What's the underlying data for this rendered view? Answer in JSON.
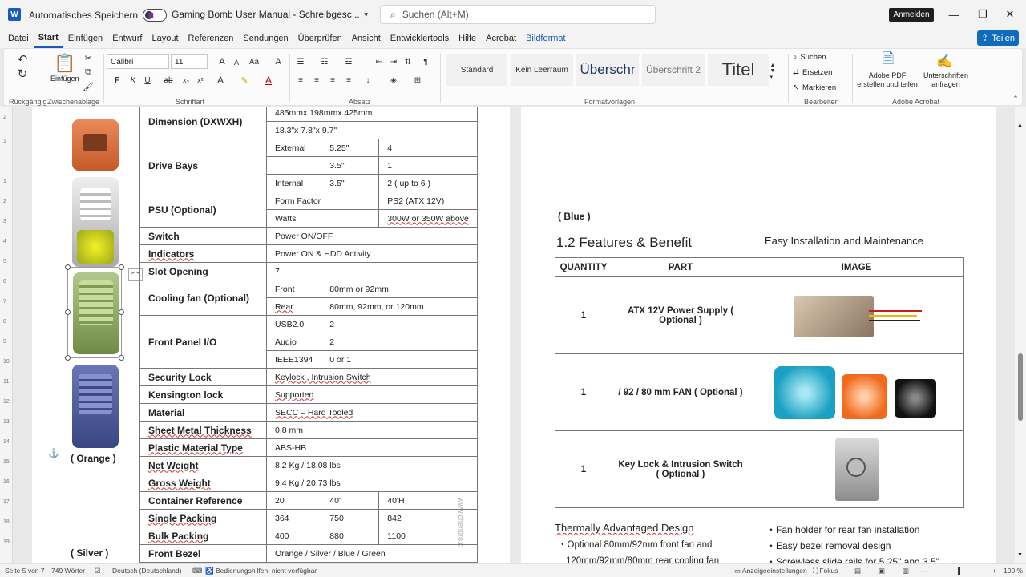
{
  "titlebar": {
    "autosave_label": "Automatisches Speichern",
    "doc_title": "Gaming Bomb User Manual - Schreibgesc...",
    "search_placeholder": "Suchen (Alt+M)",
    "signin_label": "Anmelden"
  },
  "menu": {
    "items": [
      "Datei",
      "Start",
      "Einfügen",
      "Entwurf",
      "Layout",
      "Referenzen",
      "Sendungen",
      "Überprüfen",
      "Ansicht",
      "Entwicklertools",
      "Hilfe",
      "Acrobat"
    ],
    "context_tab": "Bildformat",
    "share_label": "Teilen"
  },
  "ribbon": {
    "paste_label": "Einfügen",
    "font_name": "Calibri",
    "font_size": "11",
    "styles": [
      "Standard",
      "Kein Leerraum",
      "Überschr",
      "Überschrift 2",
      "Titel"
    ],
    "edit": {
      "find": "Suchen",
      "replace": "Ersetzen",
      "select": "Markieren"
    },
    "acrobat": {
      "create_pdf": "Adobe PDF erstellen und teilen",
      "request_sign": "Unterschriften anfragen"
    },
    "groups": {
      "undo": "Rückgängig",
      "clipboard": "Zwischenablage",
      "font": "Schriftart",
      "paragraph": "Absatz",
      "styles": "Formatvorlagen",
      "edit": "Bearbeiten",
      "acrobat": "Adobe Acrobat"
    }
  },
  "page1": {
    "caption_orange": "( Orange )",
    "caption_silver": "( Silver )",
    "watermark": "www.chenbro.c",
    "spec": {
      "dimension_label": "Dimension (DXWXH)",
      "dimension_mm": "485mmx 198mmx 425mm",
      "dimension_in": "18.3\"x 7.8\"x 9.7\"",
      "drive_label": "Drive Bays",
      "drive_ext": "External",
      "drive_int": "Internal",
      "drive_525": "5.25\"",
      "drive_35": "3.5\"",
      "drive_ext525_val": "4",
      "drive_ext35_val": "1",
      "drive_int35_val": "2 ( up to 6 )",
      "psu_label": "PSU (Optional)",
      "psu_ff": "Form Factor",
      "psu_ff_val": "PS2 (ATX 12V)",
      "psu_watts": "Watts",
      "psu_watts_val": "300W or 350W above",
      "switch_label": "Switch",
      "switch_val": "Power ON/OFF",
      "indicators_label": "Indicators",
      "indicators_val": "Power ON & HDD Activity",
      "slot_label": "Slot Opening",
      "slot_val": "7",
      "fan_label": "Cooling fan (Optional)",
      "fan_front": "Front",
      "fan_front_val": "80mm or 92mm",
      "fan_rear": "Rear",
      "fan_rear_val": "80mm, 92mm, or 120mm",
      "io_label": "Front Panel I/O",
      "io_usb": "USB2.0",
      "io_usb_val": "2",
      "io_audio": "Audio",
      "io_audio_val": "2",
      "io_ieee": "IEEE1394",
      "io_ieee_val": "0 or 1",
      "security_label": "Security Lock",
      "security_val": "Keylock , Intrusion Switch",
      "kensington_label": "Kensington lock",
      "kensington_val": "Supported",
      "material_label": "Material",
      "material_val": "SECC – Hard Tooled",
      "sheet_label": "Sheet Metal Thickness",
      "sheet_val": "0.8 mm",
      "plastic_label": "Plastic Material Type",
      "plastic_val": "ABS-HB",
      "net_label": "Net Weight",
      "net_val": "8.2 Kg / 18.08 lbs",
      "gross_label": "Gross Weight",
      "gross_val": "9.4 Kg / 20.73 lbs",
      "container_label": "Container Reference",
      "container_20": "20'",
      "container_40": "40'",
      "container_40h": "40'H",
      "single_label": "Single Packing",
      "single_20": "364",
      "single_40": "750",
      "single_40h": "842",
      "bulk_label": "Bulk Packing",
      "bulk_20": "400",
      "bulk_40": "880",
      "bulk_40h": "1100",
      "front_bezel_label": "Front Bezel",
      "front_bezel_val": "Orange / Silver / Blue / Green"
    }
  },
  "page2": {
    "caption_blue": "( Blue )",
    "heading": "1.2 Features & Benefit",
    "right_heading": "Easy Installation and Maintenance",
    "table_headers": [
      "QUANTITY",
      "PART",
      "IMAGE"
    ],
    "rows": [
      {
        "qty": "1",
        "part": "ATX 12V Power Supply ( Optional )"
      },
      {
        "qty": "1",
        "part": "/ 92 / 80 mm FAN ( Optional )"
      },
      {
        "qty": "1",
        "part": "Key Lock & Intrusion Switch ( Optional )"
      }
    ],
    "thermal_heading": "Thermally Advantaged Design",
    "thermal_bullet_1": "Optional 80mm/92mm front fan and",
    "thermal_bullet_1b": "120mm/92mm/80mm rear cooling fan",
    "right_bullets": [
      "Fan holder for rear fan installation",
      "Easy bezel removal design",
      "Screwless slide rails for 5.25\" and 3.5\""
    ]
  },
  "status": {
    "page": "Seite 5 von 7",
    "words": "749 Wörter",
    "language": "Deutsch (Deutschland)",
    "accessibility": "Bedienungshilfen: nicht verfügbar",
    "display": "Anzeigeeinstellungen",
    "focus": "Fokus",
    "zoom": "100 %"
  }
}
